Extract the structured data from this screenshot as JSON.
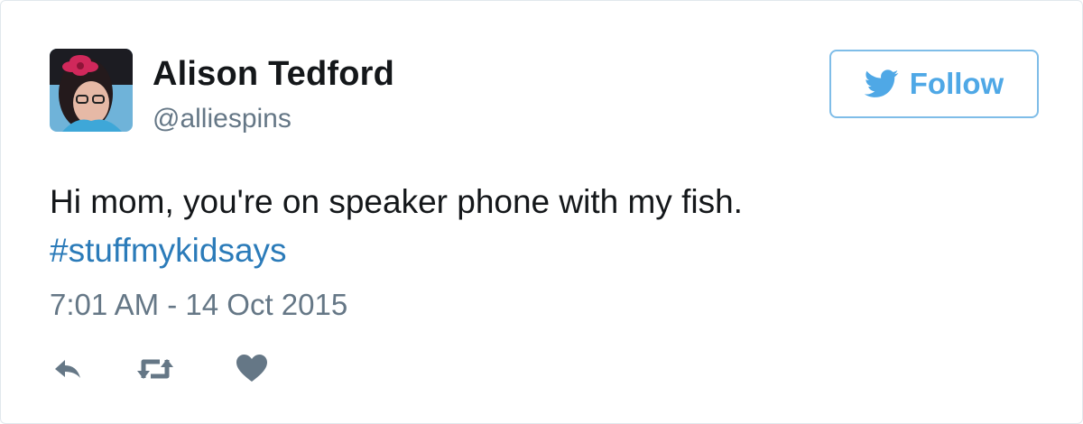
{
  "user": {
    "display_name": "Alison Tedford",
    "handle": "@alliespins"
  },
  "follow_button": {
    "label": "Follow",
    "icon": "twitter-bird-icon"
  },
  "tweet": {
    "text": "Hi mom, you're on speaker phone with my fish.",
    "hashtag": "#stuffmykidsays",
    "timestamp": "7:01 AM - 14 Oct 2015"
  },
  "actions": [
    {
      "icon": "reply-icon"
    },
    {
      "icon": "retweet-icon"
    },
    {
      "icon": "like-icon"
    }
  ],
  "colors": {
    "text": "#14171a",
    "muted": "#657786",
    "link": "#2b7bb9",
    "follow_blue": "#4fa8e6",
    "follow_border": "#7fbde8",
    "card_border": "#e1e8ed"
  }
}
